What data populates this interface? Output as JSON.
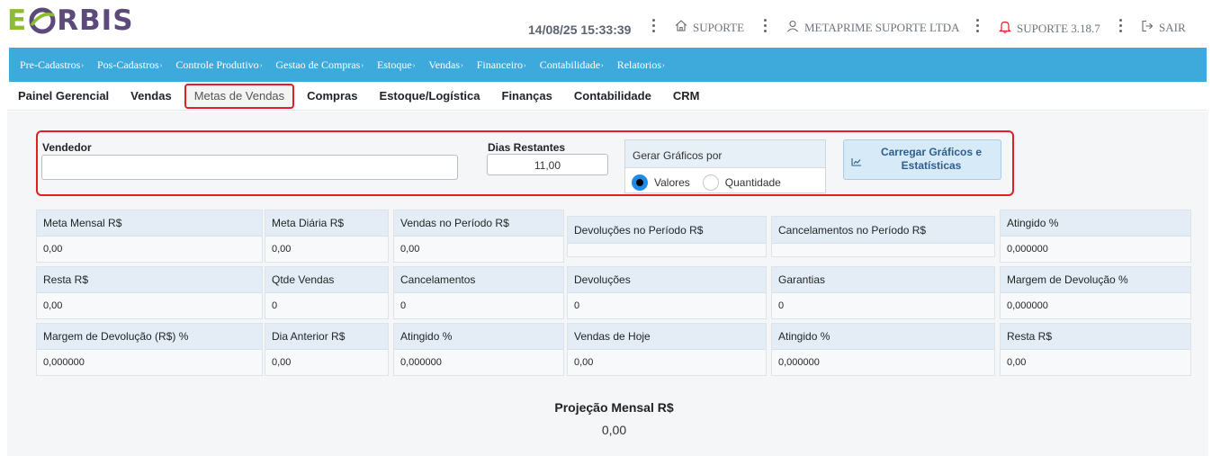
{
  "brand": {
    "logo_left": "E",
    "logo_right": "RBIS",
    "colors": {
      "green": "#8bbd2e",
      "purple": "#5b4a7a"
    }
  },
  "header": {
    "datetime": "14/08/25 15:33:39",
    "support_link": "SUPORTE",
    "company": "METAPRIME SUPORTE LTDA",
    "notif_label": "SUPORTE 3.18.7",
    "logout": "SAIR"
  },
  "menu": [
    {
      "label": "Pre-Cadastros"
    },
    {
      "label": "Pos-Cadastros"
    },
    {
      "label": "Controle Produtivo"
    },
    {
      "label": "Gestao de Compras"
    },
    {
      "label": "Estoque"
    },
    {
      "label": "Vendas"
    },
    {
      "label": "Financeiro"
    },
    {
      "label": "Contabilidade"
    },
    {
      "label": "Relatorios"
    }
  ],
  "tabs": [
    {
      "label": "Painel Gerencial"
    },
    {
      "label": "Vendas"
    },
    {
      "label": "Metas de Vendas"
    },
    {
      "label": "Compras"
    },
    {
      "label": "Estoque/Logística"
    },
    {
      "label": "Finanças"
    },
    {
      "label": "Contabilidade"
    },
    {
      "label": "CRM"
    }
  ],
  "filters": {
    "vendedor_label": "Vendedor",
    "vendedor_value": "",
    "dias_label": "Dias Restantes",
    "dias_value": "11,00",
    "gerar_label": "Gerar Gráficos por",
    "radio_valores": "Valores",
    "radio_quantidade": "Quantidade",
    "load_button": "Carregar Gráficos e Estatísticas"
  },
  "cards": [
    {
      "label": "Meta Mensal R$",
      "value": "0,00"
    },
    {
      "label": "Meta Diária R$",
      "value": "0,00"
    },
    {
      "label": "Vendas no Período R$",
      "value": "0,00"
    },
    {
      "label": "Devoluções no Período R$",
      "value": ""
    },
    {
      "label": "Cancelamentos no Período R$",
      "value": ""
    },
    {
      "label": "Atingido %",
      "value": "0,000000"
    },
    {
      "label": "Resta R$",
      "value": "0,00"
    },
    {
      "label": "Qtde Vendas",
      "value": "0"
    },
    {
      "label": "Cancelamentos",
      "value": "0"
    },
    {
      "label": "Devoluções",
      "value": "0"
    },
    {
      "label": "Garantias",
      "value": "0"
    },
    {
      "label": "Margem de Devolução %",
      "value": "0,000000"
    },
    {
      "label": "Margem de Devolução (R$) %",
      "value": "0,000000"
    },
    {
      "label": "Dia Anterior R$",
      "value": "0,00"
    },
    {
      "label": "Atingido %",
      "value": "0,000000"
    },
    {
      "label": "Vendas de Hoje",
      "value": "0,00"
    },
    {
      "label": "Atingido %",
      "value": "0,000000"
    },
    {
      "label": "Resta R$",
      "value": "0,00"
    }
  ],
  "projection": {
    "title": "Projeção Mensal R$",
    "value": "0,00"
  }
}
